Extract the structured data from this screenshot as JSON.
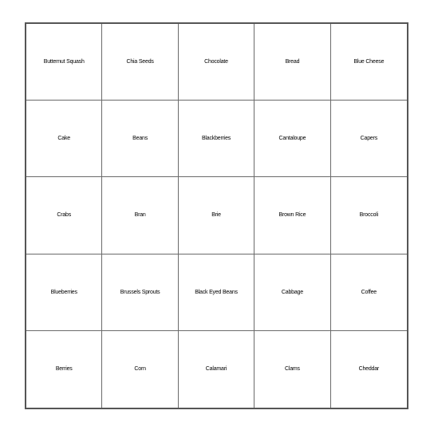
{
  "card": {
    "type": "bingo-card",
    "columns": 5,
    "rows": 5,
    "text_color": "#000000",
    "background_color": "#ffffff",
    "grid_line_color": "#6b6b6b",
    "outer_border_color": "#555555",
    "cells": [
      [
        {
          "label": "Butternut Squash",
          "size": "sm"
        },
        {
          "label": "Chia Seeds",
          "size": "xl"
        },
        {
          "label": "Chocolate",
          "size": "s"
        },
        {
          "label": "Bread",
          "size": "xxl"
        },
        {
          "label": "Blue Cheese",
          "size": "ml"
        }
      ],
      [
        {
          "label": "Cake",
          "size": "xxxl"
        },
        {
          "label": "Beans",
          "size": "l"
        },
        {
          "label": "Blackberries",
          "size": "xs"
        },
        {
          "label": "Cantaloupe",
          "size": "s"
        },
        {
          "label": "Capers",
          "size": "ml"
        }
      ],
      [
        {
          "label": "Crabs",
          "size": "l"
        },
        {
          "label": "Bran",
          "size": "xxxl"
        },
        {
          "label": "Brie",
          "size": "xxxl"
        },
        {
          "label": "Brown Rice",
          "size": "ml"
        },
        {
          "label": "Broccoli",
          "size": "sm"
        }
      ],
      [
        {
          "label": "Blueberries",
          "size": "xs"
        },
        {
          "label": "Brussels Sprouts",
          "size": "m"
        },
        {
          "label": "Black Eyed Beans",
          "size": "m"
        },
        {
          "label": "Cabbage",
          "size": "s"
        },
        {
          "label": "Coffee",
          "size": "ml"
        }
      ],
      [
        {
          "label": "Berries",
          "size": "m"
        },
        {
          "label": "Corn",
          "size": "xxxl"
        },
        {
          "label": "Calamari",
          "size": "sm"
        },
        {
          "label": "Clams",
          "size": "l"
        },
        {
          "label": "Cheddar",
          "size": "sm"
        }
      ]
    ]
  }
}
